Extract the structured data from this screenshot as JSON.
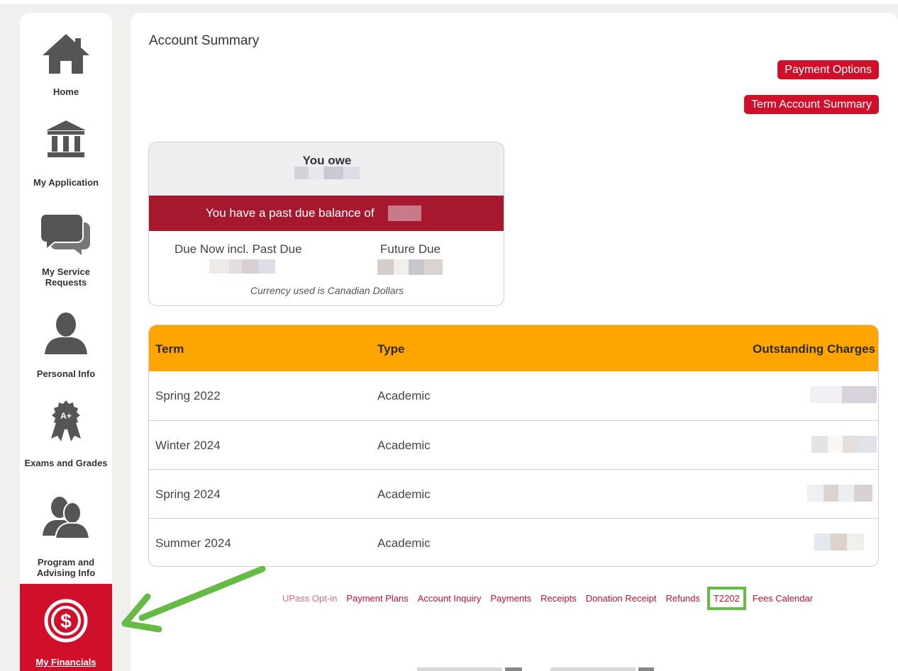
{
  "sidebar": {
    "items": [
      {
        "label": "Home",
        "icon": "house-icon"
      },
      {
        "label": "My Application",
        "icon": "bank-icon"
      },
      {
        "label": "My Service Requests",
        "icon": "chat-bubbles-icon"
      },
      {
        "label": "Personal Info",
        "icon": "person-icon"
      },
      {
        "label": "Exams and Grades",
        "icon": "award-ribbon-icon",
        "badge": "A+"
      },
      {
        "label": "Program and Advising Info",
        "icon": "people-icon"
      },
      {
        "label": "My Financials",
        "icon": "dollar-coin-icon",
        "active": true
      }
    ]
  },
  "main": {
    "title": "Account Summary",
    "buttons": {
      "payment_options": "Payment Options",
      "term_account_summary": "Term Account Summary"
    },
    "balance_card": {
      "you_owe_label": "You owe",
      "past_due_text": "You have a past due balance of",
      "due_now_label": "Due Now incl. Past Due",
      "future_due_label": "Future Due",
      "currency_note": "Currency used is Canadian Dollars"
    },
    "table": {
      "headers": {
        "term": "Term",
        "type": "Type",
        "outstanding": "Outstanding Charges"
      },
      "rows": [
        {
          "term": "Spring 2022",
          "type": "Academic"
        },
        {
          "term": "Winter 2024",
          "type": "Academic"
        },
        {
          "term": "Spring 2024",
          "type": "Academic"
        },
        {
          "term": "Summer 2024",
          "type": "Academic"
        }
      ]
    },
    "links": [
      {
        "label": "UPass Opt-in"
      },
      {
        "label": "Payment Plans"
      },
      {
        "label": "Account Inquiry"
      },
      {
        "label": "Payments"
      },
      {
        "label": "Receipts"
      },
      {
        "label": "Donation Receipt"
      },
      {
        "label": "Refunds"
      },
      {
        "label": "T2202",
        "highlighted": true
      },
      {
        "label": "Fees Calendar"
      }
    ]
  },
  "colors": {
    "accent_red": "#d0102a",
    "past_due_red": "#a6182e",
    "table_header_orange": "#ffa500",
    "annotation_green": "#66bb44"
  }
}
